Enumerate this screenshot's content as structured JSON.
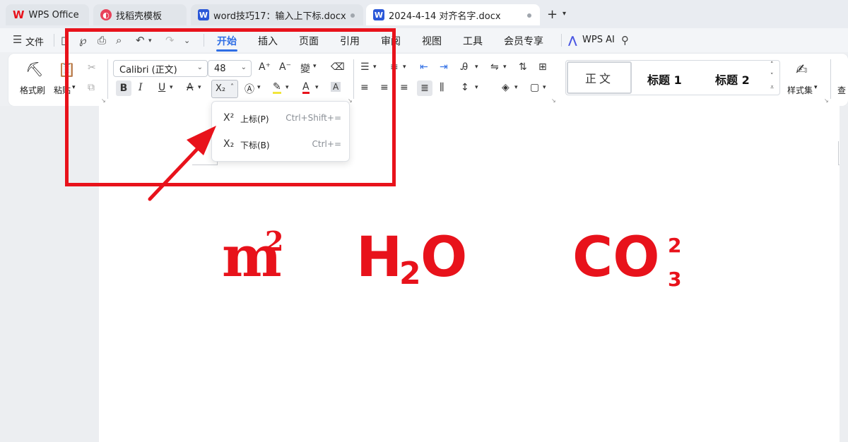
{
  "tabs": [
    {
      "label": "WPS Office",
      "icon": "wps-logo-icon",
      "color": "#e8121b"
    },
    {
      "label": "找稻壳模板",
      "icon": "docer-icon",
      "color": "#e8425a"
    },
    {
      "label": "word技巧17：输入上下标.docx",
      "icon": "word-doc-icon",
      "color": "#2b58d8"
    },
    {
      "label": "2024-4-14 对齐名字.docx",
      "icon": "word-doc-icon",
      "color": "#2b58d8"
    }
  ],
  "menubar": {
    "file": "文件",
    "items": [
      "开始",
      "插入",
      "页面",
      "引用",
      "审阅",
      "视图",
      "工具",
      "会员专享"
    ],
    "active": "开始",
    "wps_ai": "WPS AI"
  },
  "ribbon": {
    "format_painter": "格式刷",
    "paste": "粘贴",
    "font_name": "Calibri (正文)",
    "font_size": "48",
    "styles": {
      "normal": "正文",
      "h1": "标题 1",
      "h2": "标题 2"
    },
    "style_set": "样式集",
    "find": "查"
  },
  "dropdown": {
    "items": [
      {
        "icon": "X²",
        "label": "上标(P)",
        "shortcut": "Ctrl+Shift+="
      },
      {
        "icon": "X₂",
        "label": "下标(B)",
        "shortcut": "Ctrl+="
      }
    ]
  },
  "document": {
    "formula1_base": "m",
    "formula1_sup": "2",
    "formula2_a": "H",
    "formula2_sub": "2",
    "formula2_b": "O",
    "formula3_base": "CO",
    "formula3_sup": "2",
    "formula3_sub": "3"
  },
  "colors": {
    "accent": "#2f6ee5",
    "annotation": "#e8121b"
  }
}
